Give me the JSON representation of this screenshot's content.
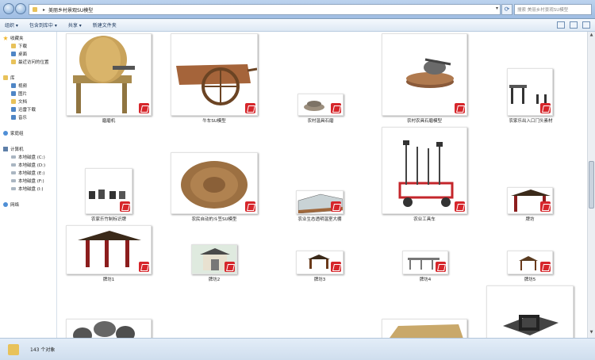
{
  "addressbar": {
    "path": [
      "美丽乡村景观SU模型"
    ],
    "search_placeholder": "搜索 美丽乡村景观SU模型"
  },
  "toolbar": {
    "organize": "组织 ▾",
    "include": "包含到库中 ▾",
    "share": "共享 ▾",
    "new_folder": "新建文件夹"
  },
  "sidebar": {
    "favorites": "收藏夹",
    "fav_items": [
      "下载",
      "桌面",
      "最近访问的位置"
    ],
    "libraries": "库",
    "lib_items": [
      "视频",
      "图片",
      "文档",
      "迅雷下载",
      "音乐"
    ],
    "homegroup": "家庭组",
    "computer": "计算机",
    "drives": [
      "本地磁盘 (C:)",
      "本地磁盘 (D:)",
      "本地磁盘 (E:)",
      "本地磁盘 (F:)",
      "本地磁盘 (I:)"
    ],
    "network": "网络"
  },
  "files": [
    {
      "name": "磨磨机"
    },
    {
      "name": "牛车SU模型"
    },
    {
      "name": "农村温具石磨"
    },
    {
      "name": "农村农具石磨模型"
    },
    {
      "name": "农家乐出入口门头素材"
    },
    {
      "name": "农家乐竹制标识牌"
    },
    {
      "name": "农民自动的斗笠SU模型"
    },
    {
      "name": "农业生态透明温室大棚"
    },
    {
      "name": "农业工具车"
    },
    {
      "name": "牌坊"
    },
    {
      "name": "牌坊1"
    },
    {
      "name": "牌坊2"
    },
    {
      "name": "牌坊3"
    },
    {
      "name": "牌坊4"
    },
    {
      "name": "牌坊5"
    }
  ],
  "status": {
    "count": "143 个对象"
  },
  "colors": {
    "sketchup_badge": "#d6262b",
    "toolbar_bg": "#dde8f4",
    "accent": "#4f86c6"
  }
}
